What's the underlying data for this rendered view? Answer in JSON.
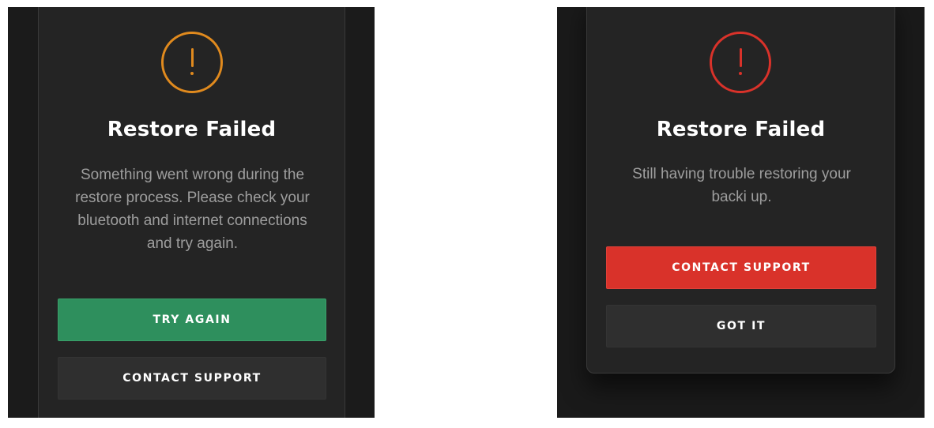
{
  "colors": {
    "warning_orange": "#e08a1e",
    "error_red": "#d9322a",
    "success_green": "#2e8f5d",
    "dark_button": "#2f2f2f"
  },
  "left_dialog": {
    "icon": "alert-circle-icon",
    "title": "Restore Failed",
    "message": "Something went wrong during the\nrestore process. Please check your\nbluetooth and internet connections\nand try again.",
    "primary_button": "TRY AGAIN",
    "secondary_button": "CONTACT SUPPORT"
  },
  "right_dialog": {
    "icon": "alert-circle-icon",
    "title": "Restore Failed",
    "message": "Still having trouble restoring your\nbacki up.",
    "primary_button": "CONTACT SUPPORT",
    "secondary_button": "GOT IT"
  }
}
